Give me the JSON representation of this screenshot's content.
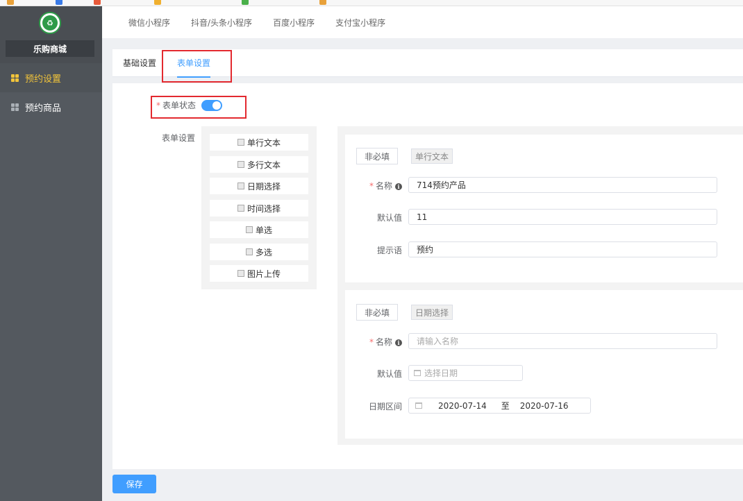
{
  "brand": {
    "name": "乐购商城",
    "logo_glyph": "♻"
  },
  "sidebar": {
    "items": [
      {
        "label": "预约设置",
        "icon": "grid-icon",
        "active": true
      },
      {
        "label": "预约商品",
        "icon": "grid-icon",
        "active": false
      }
    ]
  },
  "platform_tabs": [
    "微信小程序",
    "抖音/头条小程序",
    "百度小程序",
    "支付宝小程序"
  ],
  "sub_tabs": {
    "basic": "基础设置",
    "form": "表单设置"
  },
  "form_status": {
    "label": "表单状态",
    "enabled": true
  },
  "form_settings_label": "表单设置",
  "palette": [
    "单行文本",
    "多行文本",
    "日期选择",
    "时间选择",
    "单选",
    "多选",
    "图片上传"
  ],
  "field1": {
    "required_btn": "非必填",
    "type_tag": "单行文本",
    "name_label": "名称",
    "name_value": "714预约产品",
    "default_label": "默认值",
    "default_value": "11",
    "hint_label": "提示语",
    "hint_value": "预约"
  },
  "field2": {
    "required_btn": "非必填",
    "type_tag": "日期选择",
    "name_label": "名称",
    "name_placeholder": "请输入名称",
    "default_label": "默认值",
    "default_placeholder": "选择日期",
    "range_label": "日期区间",
    "range_start": "2020-07-14",
    "range_sep": "至",
    "range_end": "2020-07-16"
  },
  "save_label": "保存",
  "colors": {
    "accent": "#409eff",
    "sidebar": "#54595f",
    "active_menu": "#f2c43a",
    "highlight_box": "#e3292f",
    "required": "#f56c6c"
  }
}
